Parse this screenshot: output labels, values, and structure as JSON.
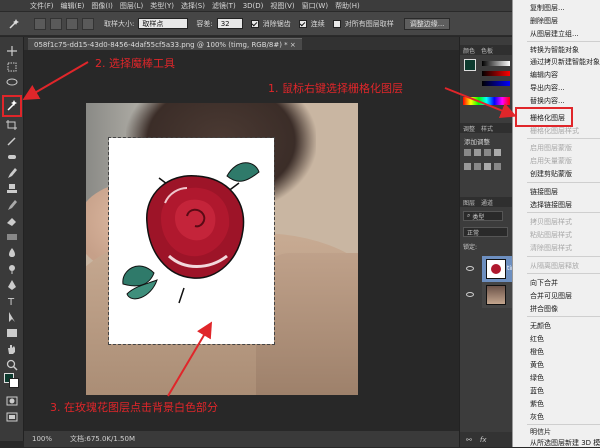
{
  "menubar": {
    "items": [
      "文件(F)",
      "编辑(E)",
      "图像(I)",
      "图层(L)",
      "类型(Y)",
      "选择(S)",
      "滤镜(T)",
      "3D(D)",
      "视图(V)",
      "窗口(W)",
      "帮助(H)"
    ]
  },
  "options": {
    "sample_size_label": "取样大小:",
    "sample_size_value": "取样点",
    "tolerance_label": "容差:",
    "tolerance_value": "32",
    "antialias_label": "消除锯齿",
    "contiguous_label": "连续",
    "all_layers_label": "对所有图层取样",
    "refine_edge_button": "调整边缘..."
  },
  "document": {
    "tab_title": "058f1c75-dd15-43d0-8456-4daf55cf5a33.png @ 100% (timg, RGB/8#) *  ×"
  },
  "statusbar": {
    "zoom": "100%",
    "doc_info": "文档:675.0K/1.50M"
  },
  "panels": {
    "color_tabs": [
      "颜色",
      "色板"
    ],
    "adjust_tabs": [
      "调整",
      "样式"
    ],
    "adjust_title": "添加调整",
    "layers_tabs": [
      "图层",
      "通道"
    ],
    "kind_label": "类型",
    "blend_mode": "正常",
    "lock_label": "锁定:",
    "layer1_name": "tim"
  },
  "context_menu": {
    "items": [
      {
        "label": "复制图层...",
        "disabled": false
      },
      {
        "label": "删除图层",
        "disabled": false
      },
      {
        "label": "从图层建立组...",
        "disabled": false
      },
      {
        "label": "转换为智能对象",
        "disabled": false
      },
      {
        "label": "通过拷贝新建智能对象",
        "disabled": false
      },
      {
        "label": "编辑内容",
        "disabled": false
      },
      {
        "label": "导出内容...",
        "disabled": false
      },
      {
        "label": "替换内容...",
        "disabled": false
      },
      {
        "label": "栅格化图层",
        "disabled": false
      },
      {
        "label": "栅格化图层样式",
        "disabled": true
      },
      {
        "label": "启用图层蒙版",
        "disabled": true
      },
      {
        "label": "启用矢量蒙版",
        "disabled": true
      },
      {
        "label": "创建剪贴蒙版",
        "disabled": false
      },
      {
        "label": "链接图层",
        "disabled": false
      },
      {
        "label": "选择链接图层",
        "disabled": false
      },
      {
        "label": "拷贝图层样式",
        "disabled": true
      },
      {
        "label": "粘贴图层样式",
        "disabled": true
      },
      {
        "label": "清除图层样式",
        "disabled": true
      },
      {
        "label": "从隔离图层释放",
        "disabled": true
      },
      {
        "label": "向下合并",
        "disabled": false
      },
      {
        "label": "合并可见图层",
        "disabled": false
      },
      {
        "label": "拼合图像",
        "disabled": false
      },
      {
        "label": "无颜色",
        "disabled": false
      },
      {
        "label": "红色",
        "disabled": false
      },
      {
        "label": "橙色",
        "disabled": false
      },
      {
        "label": "黄色",
        "disabled": false
      },
      {
        "label": "绿色",
        "disabled": false
      },
      {
        "label": "蓝色",
        "disabled": false
      },
      {
        "label": "紫色",
        "disabled": false
      },
      {
        "label": "灰色",
        "disabled": false
      },
      {
        "label": "明信片",
        "disabled": false
      },
      {
        "label": "从所选图层新建 3D 模",
        "disabled": false
      }
    ]
  },
  "annotations": {
    "step1": "1. 鼠标右键选择栅格化图层",
    "step2": "2. 选择魔棒工具",
    "step3": "3. 在玫瑰花图层点击背景白色部分"
  },
  "colors": {
    "annotation_red": "#e0262a",
    "rose_red": "#b0182e",
    "leaf_teal": "#2f7a6a"
  }
}
